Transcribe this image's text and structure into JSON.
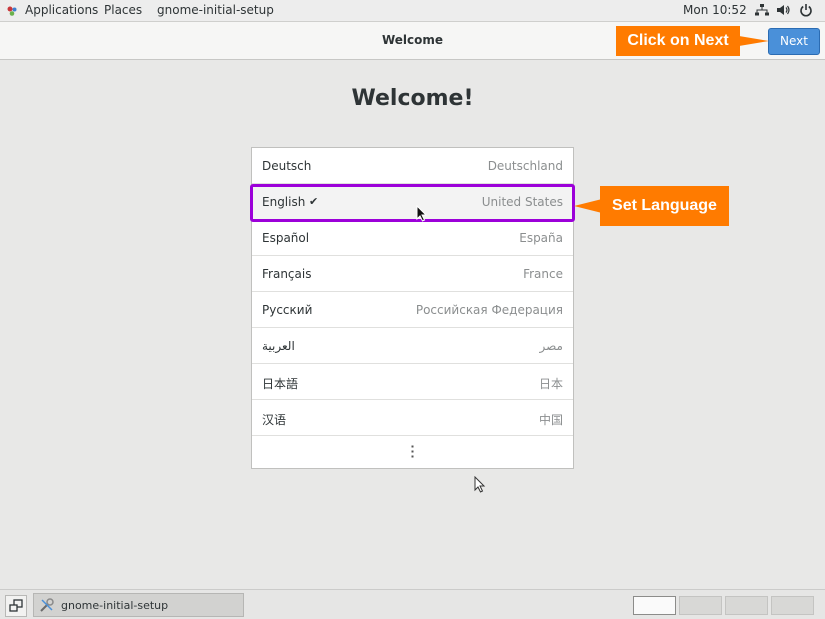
{
  "top_panel": {
    "applications": "Applications",
    "places": "Places",
    "active_app": "gnome-initial-setup",
    "clock": "Mon 10:52",
    "tray_icons": [
      "network-icon",
      "volume-icon",
      "power-icon"
    ]
  },
  "header": {
    "title": "Welcome",
    "next_label": "Next"
  },
  "callouts": {
    "next": "Click on Next",
    "language": "Set Language"
  },
  "welcome": {
    "title": "Welcome!"
  },
  "languages": [
    {
      "name": "Deutsch",
      "region": "Deutschland"
    },
    {
      "name": "English",
      "region": "United States",
      "selected": true
    },
    {
      "name": "Español",
      "region": "España"
    },
    {
      "name": "Français",
      "region": "France"
    },
    {
      "name": "Русский",
      "region": "Российская Федерация"
    },
    {
      "name": "العربية",
      "region": "مصر"
    },
    {
      "name": "日本語",
      "region": "日本"
    },
    {
      "name": "汉语",
      "region": "中国"
    }
  ],
  "taskbar": {
    "task_label": "gnome-initial-setup",
    "workspaces": 4,
    "active_workspace": 1
  },
  "colors": {
    "accent": "#4a90d9",
    "callout": "#ff7b00",
    "selection_outline": "#9c00d9"
  }
}
